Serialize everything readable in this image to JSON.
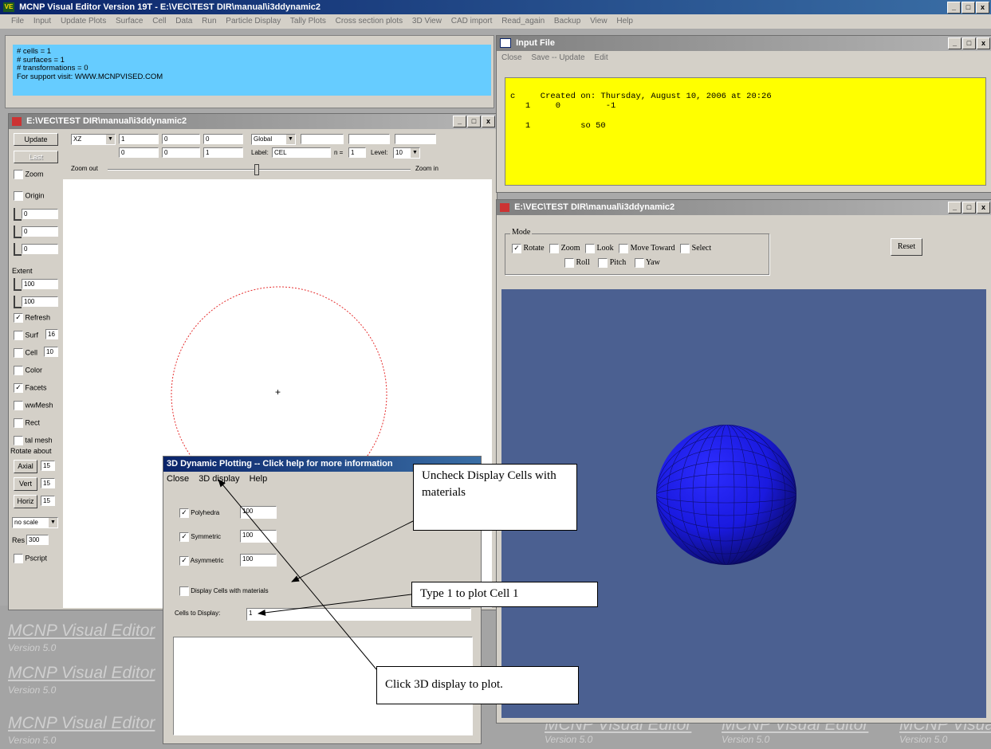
{
  "main_window": {
    "title": "MCNP Visual Editor Version 19T - E:\\VEC\\TEST DIR\\manual\\i3ddynamic2",
    "menu": [
      "File",
      "Input",
      "Update Plots",
      "Surface",
      "Cell",
      "Data",
      "Run",
      "Particle Display",
      "Tally Plots",
      "Cross section plots",
      "3D View",
      "CAD import",
      "Read_again",
      "Backup",
      "View",
      "Help"
    ],
    "controls": [
      "_",
      "□",
      "X"
    ]
  },
  "info_panel": {
    "lines": [
      "# cells = 1",
      "# surfaces = 1",
      "# transformations = 0",
      "For support visit: WWW.MCNPVISED.COM"
    ]
  },
  "plot_window": {
    "title": "E:\\VEC\\TEST DIR\\manual\\i3ddynamic2",
    "update_label": "Update",
    "last_label": "Last",
    "plane_select": "XZ",
    "origin_row1": [
      "1",
      "0",
      "0"
    ],
    "origin_row2": [
      "0",
      "0",
      "1"
    ],
    "global_select": "Global",
    "label_prefix": "Label:",
    "label_value": "CEL",
    "label_n_prefix": "n =",
    "label_n_value": "1",
    "level_prefix": "Level:",
    "level_value": "10",
    "zoom_out": "Zoom out",
    "zoom_in": "Zoom in",
    "sidebar": {
      "zoom": "Zoom",
      "origin": "Origin",
      "origin_vals": [
        "0",
        "0",
        "0"
      ],
      "extent": "Extent",
      "extent_vals": [
        "100",
        "100"
      ],
      "refresh": "Refresh",
      "surf": "Surf",
      "surf_val": "16",
      "cell": "Cell",
      "cell_val": "10",
      "color": "Color",
      "facets": "Facets",
      "wwmesh": "wwMesh",
      "rect": "Rect",
      "talmesh": "tal mesh",
      "rotate_about": "Rotate about",
      "axial": "Axial",
      "axial_val": "15",
      "vert": "Vert",
      "vert_val": "15",
      "horiz": "Horiz",
      "horiz_val": "15",
      "scale_select": "no scale",
      "res_label": "Res",
      "res_val": "300",
      "pscript": "Pscript"
    },
    "center_mark": "+"
  },
  "input_window": {
    "title": "Input File",
    "menu": [
      "Close",
      "Save -- Update",
      "Edit"
    ],
    "lines": [
      "c     Created on: Thursday, August 10, 2006 at 20:26",
      "   1     0         -1",
      "",
      "   1          so 50"
    ]
  },
  "view3d_window": {
    "title": "E:\\VEC\\TEST DIR\\manual\\i3ddynamic2",
    "mode_label": "Mode",
    "modes_row1": [
      "Rotate",
      "Zoom",
      "Look",
      "Move Toward",
      "Select"
    ],
    "modes_row2": [
      "Roll",
      "Pitch",
      "Yaw"
    ],
    "reset_label": "Reset",
    "sphere_color": "#1a1adf",
    "background_color": "#4b6091"
  },
  "dynamic_dialog": {
    "title": "3D Dynamic Plotting -- Click help for more information",
    "menu": [
      "Close",
      "3D display",
      "Help"
    ],
    "rows": [
      {
        "label": "Polyhedra",
        "value": "100"
      },
      {
        "label": "Symmetric",
        "value": "100"
      },
      {
        "label": "Asymmetric",
        "value": "100"
      }
    ],
    "display_cells_label": "Display Cells with materials",
    "cells_to_display_label": "Cells to Display:",
    "cells_to_display_value": "1"
  },
  "callouts": {
    "uncheck": "Uncheck Display Cells with materials",
    "type1": "Type 1 to plot Cell 1",
    "click3d": "Click 3D display to plot."
  },
  "watermarks": {
    "title": "MCNP Visual Editor",
    "version": "Version 5.0"
  }
}
